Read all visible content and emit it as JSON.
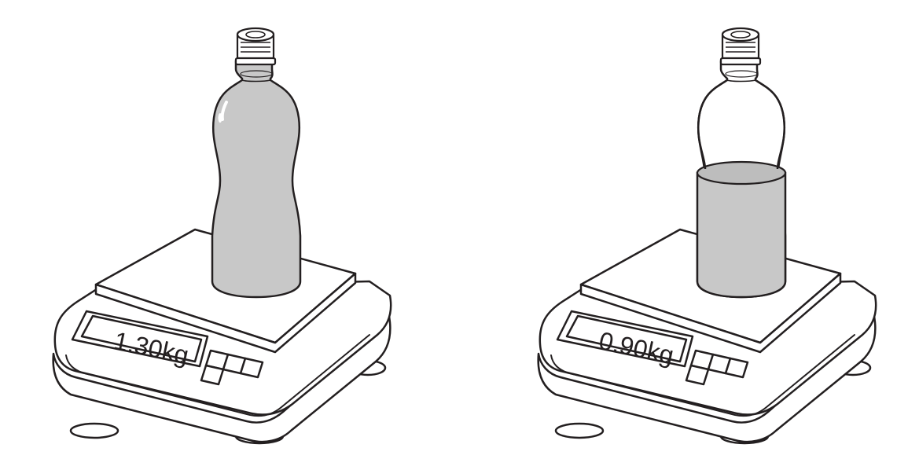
{
  "scales": [
    {
      "reading": "1.30kg",
      "bottom_fill": "full"
    },
    {
      "reading": "0.90kg",
      "bottom_fill": "partial"
    }
  ],
  "colors": {
    "outline": "#231f20",
    "liquid": "#c8c8c8",
    "liquid_surface": "#bdbdbd",
    "background": "#ffffff"
  }
}
